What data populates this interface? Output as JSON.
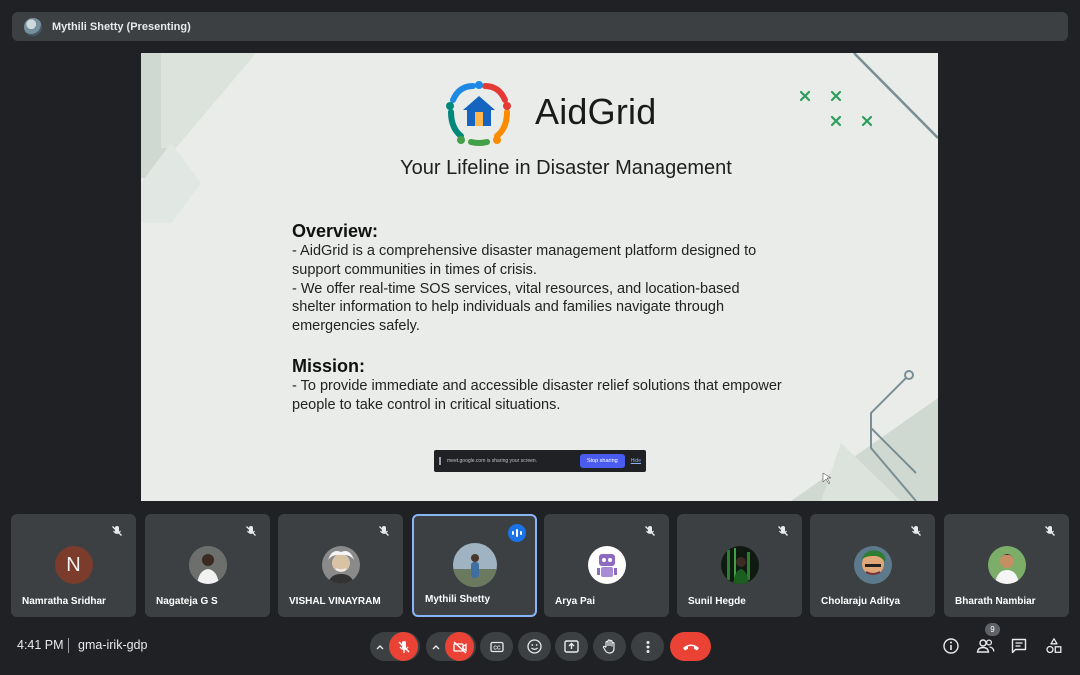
{
  "presenter": {
    "name": "Mythili Shetty (Presenting)"
  },
  "slide": {
    "brand": "AidGrid",
    "tagline": "Your Lifeline in Disaster Management",
    "overview_heading": "Overview:",
    "overview_lines": [
      "- AidGrid is a comprehensive disaster management platform designed to support communities in times of crisis.",
      "- We offer real-time SOS services, vital resources, and location-based shelter information to help individuals and families navigate through emergencies safely."
    ],
    "mission_heading": "Mission:",
    "mission_lines": [
      "- To provide immediate and accessible disaster relief solutions that empower people to take control in critical situations."
    ],
    "share_bar": {
      "text": "meet.google.com is sharing your screen.",
      "stop_label": "Stop sharing",
      "hide_label": "Hide"
    }
  },
  "participants": [
    {
      "name": "Namratha Sridhar",
      "initial": "N",
      "avatar": "letter",
      "muted": true
    },
    {
      "name": "Nagateja G S",
      "avatar": "photo-person-white-shirt",
      "muted": true
    },
    {
      "name": "VISHAL VINAYRAM",
      "avatar": "photo-einstein",
      "muted": true
    },
    {
      "name": "Mythili Shetty",
      "avatar": "photo-person-outdoor",
      "speaking": true
    },
    {
      "name": "Arya Pai",
      "avatar": "photo-robot",
      "muted": true
    },
    {
      "name": "Sunil Hegde",
      "avatar": "photo-dark-green",
      "muted": true
    },
    {
      "name": "Cholaraju Aditya",
      "avatar": "photo-anime",
      "muted": true
    },
    {
      "name": "Bharath Nambiar",
      "avatar": "photo-person-smiling",
      "muted": true
    }
  ],
  "bottom_bar": {
    "time": "4:41 PM",
    "meeting_code": "gma-irik-gdp",
    "people_count": "9"
  },
  "colors": {
    "background": "#202124",
    "tile": "#3c4043",
    "danger": "#ea4335",
    "accent": "#8ab4f8",
    "slide_bg": "#e9ece9",
    "slide_accent_green": "#2e9e5c"
  },
  "icons": {
    "mic_off": "mic-off-icon",
    "camera_off": "camera-off-icon",
    "captions": "captions-icon",
    "emoji": "emoji-icon",
    "present": "present-icon",
    "hand": "raise-hand-icon",
    "more": "more-vert-icon",
    "end_call": "end-call-icon",
    "info": "info-icon",
    "people": "people-icon",
    "chat": "chat-icon",
    "activities": "activities-icon"
  }
}
